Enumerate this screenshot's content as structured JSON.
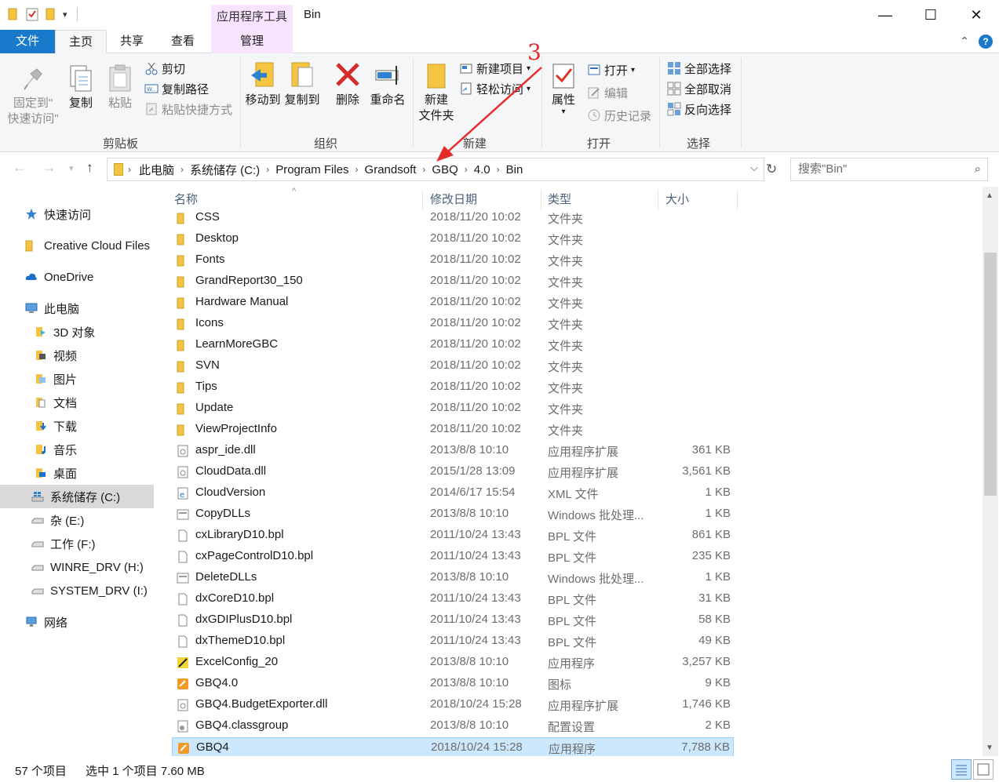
{
  "window": {
    "title": "Bin",
    "context_tab_group": "应用程序工具",
    "controls": {
      "minimize": "—",
      "maximize": "☐",
      "close": "✕"
    }
  },
  "tabs": {
    "file": "文件",
    "home": "主页",
    "share": "共享",
    "view": "查看",
    "manage": "管理"
  },
  "ribbon": {
    "clipboard": {
      "label": "剪贴板",
      "pin_line1": "固定到\"",
      "pin_line2": "快速访问\"",
      "copy": "复制",
      "paste": "粘贴",
      "cut": "剪切",
      "copy_path": "复制路径",
      "paste_shortcut": "粘贴快捷方式"
    },
    "organize": {
      "label": "组织",
      "move_to": "移动到",
      "copy_to": "复制到",
      "delete": "删除",
      "rename": "重命名"
    },
    "new": {
      "label": "新建",
      "new_folder_line1": "新建",
      "new_folder_line2": "文件夹",
      "new_item": "新建项目",
      "easy_access": "轻松访问"
    },
    "open": {
      "label": "打开",
      "properties": "属性",
      "open": "打开",
      "edit": "编辑",
      "history": "历史记录"
    },
    "select": {
      "label": "选择",
      "select_all": "全部选择",
      "select_none": "全部取消",
      "invert": "反向选择"
    }
  },
  "annotation": {
    "number": "3",
    "color": "#e52b2b"
  },
  "address": {
    "crumbs": [
      "此电脑",
      "系统储存 (C:)",
      "Program Files",
      "Grandsoft",
      "GBQ",
      "4.0",
      "Bin"
    ],
    "search_placeholder": "搜索\"Bin\""
  },
  "nav": {
    "items": [
      {
        "label": "快速访问",
        "icon": "star-icon"
      },
      {
        "label": "Creative Cloud Files",
        "icon": "folder-icon"
      },
      {
        "label": "OneDrive",
        "icon": "cloud-icon"
      },
      {
        "label": "此电脑",
        "icon": "computer-icon"
      },
      {
        "label": "3D 对象",
        "icon": "3d-objects-icon"
      },
      {
        "label": "视频",
        "icon": "video-icon"
      },
      {
        "label": "图片",
        "icon": "pictures-icon"
      },
      {
        "label": "文档",
        "icon": "documents-icon"
      },
      {
        "label": "下载",
        "icon": "download-icon"
      },
      {
        "label": "音乐",
        "icon": "music-icon"
      },
      {
        "label": "桌面",
        "icon": "desktop-icon"
      },
      {
        "label": "系统储存 (C:)",
        "icon": "windows-drive-icon"
      },
      {
        "label": "杂 (E:)",
        "icon": "drive-icon"
      },
      {
        "label": "工作 (F:)",
        "icon": "drive-icon"
      },
      {
        "label": "WINRE_DRV (H:)",
        "icon": "drive-icon"
      },
      {
        "label": "SYSTEM_DRV (I:)",
        "icon": "drive-icon"
      },
      {
        "label": "网络",
        "icon": "network-icon"
      }
    ]
  },
  "columns": {
    "name": "名称",
    "date": "修改日期",
    "type": "类型",
    "size": "大小"
  },
  "files": [
    {
      "name": "CSS",
      "date": "2018/11/20 10:02",
      "type": "文件夹",
      "size": "",
      "icon": "folder-icon"
    },
    {
      "name": "Desktop",
      "date": "2018/11/20 10:02",
      "type": "文件夹",
      "size": "",
      "icon": "folder-icon"
    },
    {
      "name": "Fonts",
      "date": "2018/11/20 10:02",
      "type": "文件夹",
      "size": "",
      "icon": "folder-icon"
    },
    {
      "name": "GrandReport30_150",
      "date": "2018/11/20 10:02",
      "type": "文件夹",
      "size": "",
      "icon": "folder-icon"
    },
    {
      "name": "Hardware Manual",
      "date": "2018/11/20 10:02",
      "type": "文件夹",
      "size": "",
      "icon": "folder-icon"
    },
    {
      "name": "Icons",
      "date": "2018/11/20 10:02",
      "type": "文件夹",
      "size": "",
      "icon": "folder-icon"
    },
    {
      "name": "LearnMoreGBC",
      "date": "2018/11/20 10:02",
      "type": "文件夹",
      "size": "",
      "icon": "folder-icon"
    },
    {
      "name": "SVN",
      "date": "2018/11/20 10:02",
      "type": "文件夹",
      "size": "",
      "icon": "folder-icon"
    },
    {
      "name": "Tips",
      "date": "2018/11/20 10:02",
      "type": "文件夹",
      "size": "",
      "icon": "folder-icon"
    },
    {
      "name": "Update",
      "date": "2018/11/20 10:02",
      "type": "文件夹",
      "size": "",
      "icon": "folder-icon"
    },
    {
      "name": "ViewProjectInfo",
      "date": "2018/11/20 10:02",
      "type": "文件夹",
      "size": "",
      "icon": "folder-icon"
    },
    {
      "name": "aspr_ide.dll",
      "date": "2013/8/8 10:10",
      "type": "应用程序扩展",
      "size": "361 KB",
      "icon": "dll-icon"
    },
    {
      "name": "CloudData.dll",
      "date": "2015/1/28 13:09",
      "type": "应用程序扩展",
      "size": "3,561 KB",
      "icon": "dll-icon"
    },
    {
      "name": "CloudVersion",
      "date": "2014/6/17 15:54",
      "type": "XML 文件",
      "size": "1 KB",
      "icon": "xml-icon"
    },
    {
      "name": "CopyDLLs",
      "date": "2013/8/8 10:10",
      "type": "Windows 批处理...",
      "size": "1 KB",
      "icon": "batch-icon"
    },
    {
      "name": "cxLibraryD10.bpl",
      "date": "2011/10/24 13:43",
      "type": "BPL 文件",
      "size": "861 KB",
      "icon": "file-icon"
    },
    {
      "name": "cxPageControlD10.bpl",
      "date": "2011/10/24 13:43",
      "type": "BPL 文件",
      "size": "235 KB",
      "icon": "file-icon"
    },
    {
      "name": "DeleteDLLs",
      "date": "2013/8/8 10:10",
      "type": "Windows 批处理...",
      "size": "1 KB",
      "icon": "batch-icon"
    },
    {
      "name": "dxCoreD10.bpl",
      "date": "2011/10/24 13:43",
      "type": "BPL 文件",
      "size": "31 KB",
      "icon": "file-icon"
    },
    {
      "name": "dxGDIPlusD10.bpl",
      "date": "2011/10/24 13:43",
      "type": "BPL 文件",
      "size": "58 KB",
      "icon": "file-icon"
    },
    {
      "name": "dxThemeD10.bpl",
      "date": "2011/10/24 13:43",
      "type": "BPL 文件",
      "size": "49 KB",
      "icon": "file-icon"
    },
    {
      "name": "ExcelConfig_20",
      "date": "2013/8/8 10:10",
      "type": "应用程序",
      "size": "3,257 KB",
      "icon": "excelconfig-app-icon"
    },
    {
      "name": "GBQ4.0",
      "date": "2013/8/8 10:10",
      "type": "图标",
      "size": "9 KB",
      "icon": "gbq-app-icon"
    },
    {
      "name": "GBQ4.BudgetExporter.dll",
      "date": "2018/10/24 15:28",
      "type": "应用程序扩展",
      "size": "1,746 KB",
      "icon": "dll-icon"
    },
    {
      "name": "GBQ4.classgroup",
      "date": "2013/8/8 10:10",
      "type": "配置设置",
      "size": "2 KB",
      "icon": "config-icon"
    },
    {
      "name": "GBQ4",
      "date": "2018/10/24 15:28",
      "type": "应用程序",
      "size": "7,788 KB",
      "icon": "gbq-app-icon",
      "selected": true
    }
  ],
  "status": {
    "count": "57 个项目",
    "selection": "选中 1 个项目  7.60 MB"
  },
  "colors": {
    "accent": "#1979ca",
    "selection": "#cce8ff",
    "context_tab": "#f8e4ff",
    "folder": "#f5c542"
  }
}
